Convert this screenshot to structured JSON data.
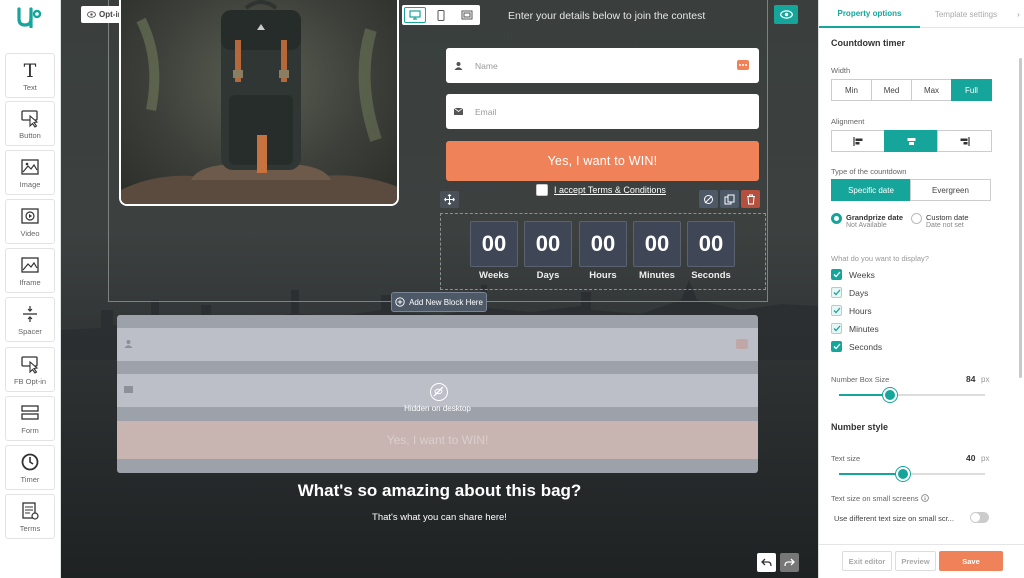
{
  "toolbar": {
    "items": [
      {
        "label": "Text",
        "icon": "text-icon"
      },
      {
        "label": "Button",
        "icon": "cursor-icon"
      },
      {
        "label": "Image",
        "icon": "image-icon"
      },
      {
        "label": "Video",
        "icon": "video-icon"
      },
      {
        "label": "Iframe",
        "icon": "iframe-icon"
      },
      {
        "label": "Spacer",
        "icon": "spacer-icon"
      },
      {
        "label": "FB Opt-in",
        "icon": "fb-optin-icon"
      },
      {
        "label": "Form",
        "icon": "form-icon"
      },
      {
        "label": "Timer",
        "icon": "timer-icon"
      },
      {
        "label": "Terms",
        "icon": "terms-icon"
      }
    ]
  },
  "canvas": {
    "optin_badge": "Opt-in pop-up",
    "contest_heading": "Enter your details below to join the contest",
    "name_placeholder": "Name",
    "email_placeholder": "Email",
    "cta_label": "Yes, I want to WIN!",
    "terms_label": "I accept Terms & Conditions",
    "countdown": [
      {
        "value": "00",
        "label": "Weeks"
      },
      {
        "value": "00",
        "label": "Days"
      },
      {
        "value": "00",
        "label": "Hours"
      },
      {
        "value": "00",
        "label": "Minutes"
      },
      {
        "value": "00",
        "label": "Seconds"
      }
    ],
    "add_block_label": "Add New Block Here",
    "hidden_label": "Hidden on desktop",
    "hidden_cta": "Yes, I want to WIN!",
    "bag_heading": "What's so amazing about this bag?",
    "bag_sub": "That's what you can share here!"
  },
  "panel": {
    "tabs": {
      "property": "Property options",
      "template": "Template settings"
    },
    "title": "Countdown timer",
    "width": {
      "label": "Width",
      "options": [
        "Min",
        "Med",
        "Max",
        "Full"
      ],
      "selected": "Full"
    },
    "alignment": {
      "label": "Alignment",
      "selected": "center"
    },
    "type": {
      "label": "Type of the countdown",
      "options": [
        "Specific date",
        "Evergreen"
      ],
      "selected": "Specific date"
    },
    "dates": {
      "grandprize": {
        "title": "Grandprize date",
        "sub": "Not Available"
      },
      "custom": {
        "title": "Custom date",
        "sub": "Date not set"
      }
    },
    "display": {
      "label": "What do you want to display?",
      "items": [
        {
          "label": "Weeks",
          "checked": true
        },
        {
          "label": "Days",
          "checked": true
        },
        {
          "label": "Hours",
          "checked": true
        },
        {
          "label": "Minutes",
          "checked": true
        },
        {
          "label": "Seconds",
          "checked": true
        }
      ]
    },
    "number_box_size": {
      "label": "Number Box Size",
      "value": "84",
      "unit": "px",
      "fraction": 0.35
    },
    "number_style": "Number style",
    "text_size": {
      "label": "Text size",
      "value": "40",
      "unit": "px",
      "fraction": 0.44
    },
    "small_screens": {
      "label": "Text size on small screens",
      "toggle_label": "Use different text size on small scr..."
    },
    "footer": {
      "exit": "Exit editor",
      "preview": "Preview",
      "save": "Save"
    }
  },
  "colors": {
    "accent": "#16a59a",
    "cta": "#ef8258",
    "box": "#3f4756"
  }
}
